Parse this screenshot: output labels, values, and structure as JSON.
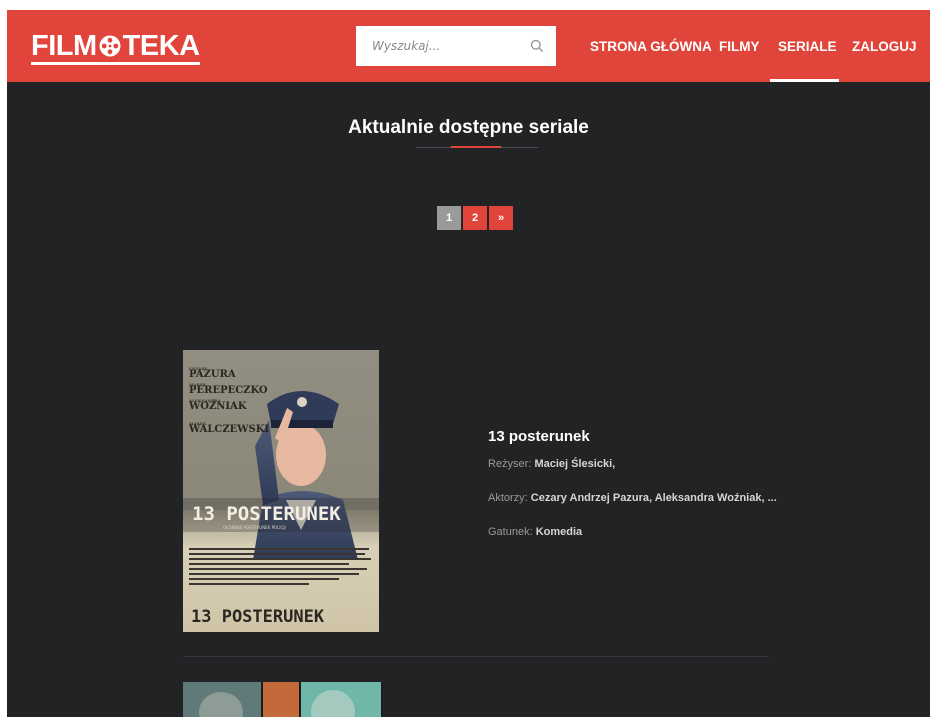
{
  "header": {
    "logo_text": "FILMOTEKA",
    "logo_part1": "FILM",
    "logo_part2": "TEKA",
    "search_placeholder": "Wyszukaj...",
    "nav": [
      {
        "label": "STRONA GŁÓWNA",
        "active": false
      },
      {
        "label": "FILMY",
        "active": false
      },
      {
        "label": "SERIALE",
        "active": true
      },
      {
        "label": "ZALOGUJ",
        "active": false
      }
    ]
  },
  "main": {
    "title": "Aktualnie dostępne seriale",
    "pagination": [
      "1",
      "2",
      "»"
    ],
    "current_page": "1"
  },
  "series": [
    {
      "title": "13 posterunek",
      "director_label": "Reżyser:",
      "director": "Maciej Ślesicki,",
      "actors_label": "Aktorzy:",
      "actors": "Cezary Andrzej Pazura, Aleksandra Woźniak, ...",
      "genre_label": "Gatunek:",
      "genre": "Komedia",
      "poster": {
        "cast_lines": [
          "PAZURA",
          "PEREPECZKO",
          "WOŹNIAK",
          "WALCZEWSKI"
        ],
        "small_names": [
          "CEZARY",
          "MAREK",
          "ALEKSANDRA",
          "MAREK"
        ],
        "title": "13 POSTERUNEK",
        "subtitle": "GŁÓWNIE POSTERUNEK POLICJI"
      }
    }
  ],
  "colors": {
    "accent": "#e0443a",
    "background": "#212325",
    "pager_active": "#9a9a9a"
  }
}
